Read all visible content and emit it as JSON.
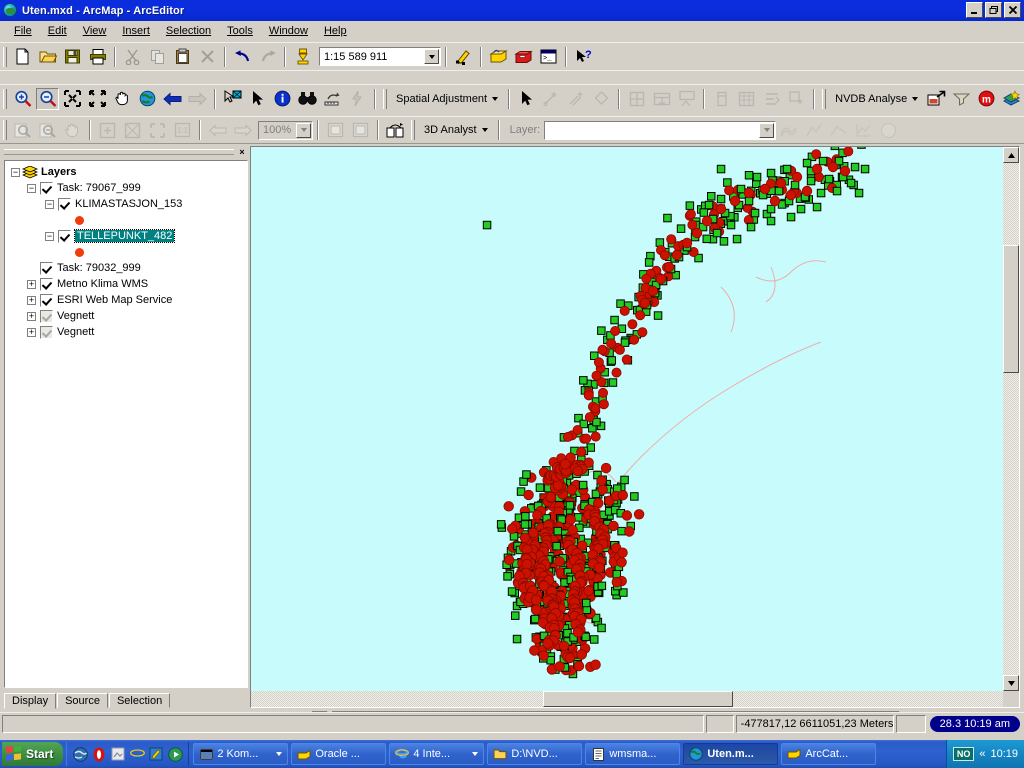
{
  "window": {
    "title": "Uten.mxd - ArcMap - ArcEditor",
    "app_icon": "arcmap-globe-icon",
    "minimize": "_",
    "restore": "❐",
    "close": "×"
  },
  "menu": {
    "items": [
      {
        "label": "File"
      },
      {
        "label": "Edit"
      },
      {
        "label": "View"
      },
      {
        "label": "Insert"
      },
      {
        "label": "Selection"
      },
      {
        "label": "Tools"
      },
      {
        "label": "Window"
      },
      {
        "label": "Help"
      }
    ]
  },
  "standard_toolbar": {
    "scale_value": "1:15 589 911",
    "buttons": [
      {
        "name": "new-document-button",
        "icon": "new-page-icon"
      },
      {
        "name": "open-document-button",
        "icon": "open-folder-icon"
      },
      {
        "name": "save-document-button",
        "icon": "floppy-disk-icon"
      },
      {
        "name": "print-button",
        "icon": "printer-icon"
      },
      {
        "name": "cut-button",
        "icon": "scissors-icon"
      },
      {
        "name": "copy-button",
        "icon": "copy-icon"
      },
      {
        "name": "paste-button",
        "icon": "clipboard-icon"
      },
      {
        "name": "delete-button",
        "icon": "x-delete-icon"
      },
      {
        "name": "undo-button",
        "icon": "undo-arrow-icon"
      },
      {
        "name": "redo-button",
        "icon": "redo-arrow-icon"
      },
      {
        "name": "add-data-button",
        "icon": "add-data-plus-icon"
      },
      {
        "name": "editor-toolbar-button",
        "icon": "editor-pencil-icon"
      },
      {
        "name": "toolbox-button",
        "icon": "toolbox-icon"
      },
      {
        "name": "arccatalog-button",
        "icon": "red-toolbox-icon"
      },
      {
        "name": "command-line-button",
        "icon": "command-window-icon"
      },
      {
        "name": "context-help-button",
        "icon": "arrow-question-icon"
      }
    ]
  },
  "tools_toolbar": {
    "buttons": [
      {
        "name": "zoom-in-tool",
        "icon": "magnifier-plus-icon"
      },
      {
        "name": "zoom-out-tool",
        "icon": "magnifier-minus-icon"
      },
      {
        "name": "fixed-zoom-in-tool",
        "icon": "fixed-zoom-in-icon"
      },
      {
        "name": "fixed-zoom-out-tool",
        "icon": "fixed-zoom-out-icon"
      },
      {
        "name": "pan-tool",
        "icon": "hand-icon"
      },
      {
        "name": "full-extent-tool",
        "icon": "globe-icon"
      },
      {
        "name": "go-back-extent-button",
        "icon": "back-arrow-icon"
      },
      {
        "name": "go-forward-extent-button",
        "icon": "forward-arrow-icon"
      },
      {
        "name": "select-features-tool",
        "icon": "select-features-icon"
      },
      {
        "name": "select-elements-tool",
        "icon": "pointer-arrow-icon"
      },
      {
        "name": "identify-tool",
        "icon": "info-circle-icon"
      },
      {
        "name": "find-tool",
        "icon": "binoculars-icon"
      },
      {
        "name": "measure-tool",
        "icon": "measure-ruler-icon"
      },
      {
        "name": "hyperlink-tool",
        "icon": "lightning-bolt-icon"
      }
    ]
  },
  "spatial_adjustment_toolbar": {
    "menu_label": "Spatial Adjustment",
    "buttons": [
      {
        "name": "select-elements-tool",
        "icon": "pointer-arrow-icon"
      },
      {
        "name": "new-displacement-link-tool",
        "icon": "displacement-link-icon"
      },
      {
        "name": "new-multiple-displacement-link-tool",
        "icon": "multi-displacement-link-icon"
      },
      {
        "name": "select-link-tool",
        "icon": "select-link-icon"
      },
      {
        "name": "edit-match-links-button",
        "icon": "grid-table-icon"
      },
      {
        "name": "attribute-transfer-button",
        "icon": "attribute-transfer-icon"
      },
      {
        "name": "edge-match-button",
        "icon": "edge-match-icon"
      },
      {
        "name": "adjust-button",
        "icon": "adjust-icon"
      },
      {
        "name": "link-table-button",
        "icon": "link-table-icon"
      },
      {
        "name": "limited-adjustment-button",
        "icon": "limited-adjust-icon"
      },
      {
        "name": "new-link-button",
        "icon": "new-link-icon"
      }
    ]
  },
  "nvdb_toolbar": {
    "menu_label": "NVDB Analyse",
    "buttons": [
      {
        "name": "nvdb-export-button",
        "icon": "export-arrow-icon"
      },
      {
        "name": "nvdb-filter-button",
        "icon": "funnel-icon"
      },
      {
        "name": "nvdb-metadata-button",
        "icon": "red-m-circle-icon"
      },
      {
        "name": "nvdb-layer-button",
        "icon": "layer-star-icon"
      },
      {
        "name": "nvdb-report-button",
        "icon": "report-icon"
      }
    ]
  },
  "layout_toolbar": {
    "zoom_value": "100%",
    "buttons": [
      {
        "name": "layout-zoom-in-tool",
        "icon": "page-magnifier-plus-icon"
      },
      {
        "name": "layout-zoom-out-tool",
        "icon": "page-magnifier-minus-icon"
      },
      {
        "name": "layout-pan-tool",
        "icon": "hand-icon"
      },
      {
        "name": "zoom-whole-page-button",
        "icon": "whole-page-icon"
      },
      {
        "name": "zoom-page-width-button",
        "icon": "page-width-icon"
      },
      {
        "name": "zoom-to-selected-button",
        "icon": "zoom-selected-icon"
      },
      {
        "name": "zoom-100-percent-button",
        "icon": "one-to-one-icon"
      },
      {
        "name": "go-back-layout-button",
        "icon": "back-page-icon"
      },
      {
        "name": "go-forward-layout-button",
        "icon": "forward-page-icon"
      },
      {
        "name": "toggle-draft-mode-button",
        "icon": "draft-mode-icon"
      },
      {
        "name": "focus-data-frame-button",
        "icon": "focus-frame-icon"
      },
      {
        "name": "change-layout-button",
        "icon": "change-layout-icon"
      }
    ]
  },
  "analyst_toolbar": {
    "menu_label": "3D Analyst",
    "layer_label": "Layer:",
    "layer_value": "",
    "buttons": [
      {
        "name": "create-contour-tool",
        "icon": "contour-icon"
      },
      {
        "name": "steepest-path-tool",
        "icon": "steepest-path-icon"
      },
      {
        "name": "line-of-sight-tool",
        "icon": "line-of-sight-icon"
      },
      {
        "name": "profile-graph-button",
        "icon": "profile-graph-icon"
      },
      {
        "name": "scene-button",
        "icon": "scene-globe-icon"
      }
    ]
  },
  "toc": {
    "close_label": "×",
    "tree": [
      {
        "name": "layer-group-root",
        "label": "Layers",
        "indent": 0,
        "expander": "-",
        "has_check": false,
        "bold": true,
        "icon": "layers-stack-icon"
      },
      {
        "name": "layer-task-79067",
        "label": "Task: 79067_999",
        "indent": 1,
        "expander": "-",
        "has_check": true,
        "checked": true
      },
      {
        "name": "layer-klimastasjon-153",
        "label": "KLIMASTASJON_153",
        "indent": 2,
        "expander": "-",
        "has_check": true,
        "checked": true
      },
      {
        "name": "layer-tellepunkt-482",
        "label": "TELLEPUNKT_482",
        "indent": 2,
        "expander": "-",
        "has_check": true,
        "checked": true,
        "selected": true
      },
      {
        "name": "layer-task-79032",
        "label": "Task: 79032_999",
        "indent": 1,
        "expander": "",
        "has_check": true,
        "checked": true
      },
      {
        "name": "layer-metno-klima-wms",
        "label": "Metno Klima WMS",
        "indent": 1,
        "expander": "+",
        "has_check": true,
        "checked": true
      },
      {
        "name": "layer-esri-web-map-service",
        "label": "ESRI Web Map Service",
        "indent": 1,
        "expander": "+",
        "has_check": true,
        "checked": true
      },
      {
        "name": "layer-vegnett-1",
        "label": "Vegnett",
        "indent": 1,
        "expander": "+",
        "has_check": true,
        "checked": true,
        "greyed": true
      },
      {
        "name": "layer-vegnett-2",
        "label": "Vegnett",
        "indent": 1,
        "expander": "+",
        "has_check": true,
        "checked": true,
        "greyed": true
      }
    ],
    "symbol_color": "#f23a0a",
    "tabs": [
      {
        "label": "Display",
        "active": true
      },
      {
        "label": "Source",
        "active": false
      },
      {
        "label": "Selection",
        "active": false
      }
    ]
  },
  "map": {
    "background_color": "#C8FCFC",
    "point_layers": [
      {
        "name": "KLIMASTASJON_153",
        "shape": "circle",
        "fill": "#cc1100",
        "outline": "#880b00"
      },
      {
        "name": "TELLEPUNKT_482",
        "shape": "square",
        "fill": "#22cc22",
        "outline": "#000000"
      }
    ],
    "road_line_color": "#f0a0a0",
    "view_buttons": [
      {
        "name": "data-view-button",
        "icon": "globe-icon"
      },
      {
        "name": "layout-view-button",
        "icon": "page-icon"
      },
      {
        "name": "refresh-view-button",
        "icon": "refresh-icon"
      },
      {
        "name": "pause-drawing-button",
        "icon": "pause-triangle-icon"
      }
    ]
  },
  "status": {
    "coordinates": "-477817,12  6611051,23 Meters",
    "clock_badge": "28.3   10:19 am"
  },
  "taskbar": {
    "start_label": "Start",
    "quick_launch": [
      {
        "name": "ql-netscape-icon",
        "icon": "netscape-globe-icon"
      },
      {
        "name": "ql-opera-icon",
        "icon": "opera-o-icon"
      },
      {
        "name": "ql-show-desktop-icon",
        "icon": "show-desktop-icon"
      },
      {
        "name": "ql-internet-explorer-icon",
        "icon": "ie-e-icon"
      },
      {
        "name": "ql-notepad-icon",
        "icon": "notepad-pencil-icon"
      },
      {
        "name": "ql-media-player-icon",
        "icon": "media-player-icon"
      }
    ],
    "tasks": [
      {
        "name": "task-kom",
        "label": "2 Kom...",
        "icon": "group-window-icon",
        "active": false,
        "group": true
      },
      {
        "name": "task-oracle",
        "label": "Oracle ...",
        "icon": "oracle-icon",
        "active": false
      },
      {
        "name": "task-internet",
        "label": "4 Inte...",
        "icon": "ie-e-icon",
        "active": false,
        "group": true
      },
      {
        "name": "task-explorer-nvd",
        "label": "D:\\NVD...",
        "icon": "folder-icon",
        "active": false
      },
      {
        "name": "task-wmsma",
        "label": "wmsma...",
        "icon": "notepad-icon",
        "active": false
      },
      {
        "name": "task-arcmap",
        "label": "Uten.m...",
        "icon": "arcmap-globe-icon",
        "active": true
      },
      {
        "name": "task-arccatalog",
        "label": "ArcCat...",
        "icon": "arccatalog-icon",
        "active": false
      }
    ],
    "tray": {
      "language": "NO",
      "chevron": "«",
      "clock": "10:19"
    }
  }
}
